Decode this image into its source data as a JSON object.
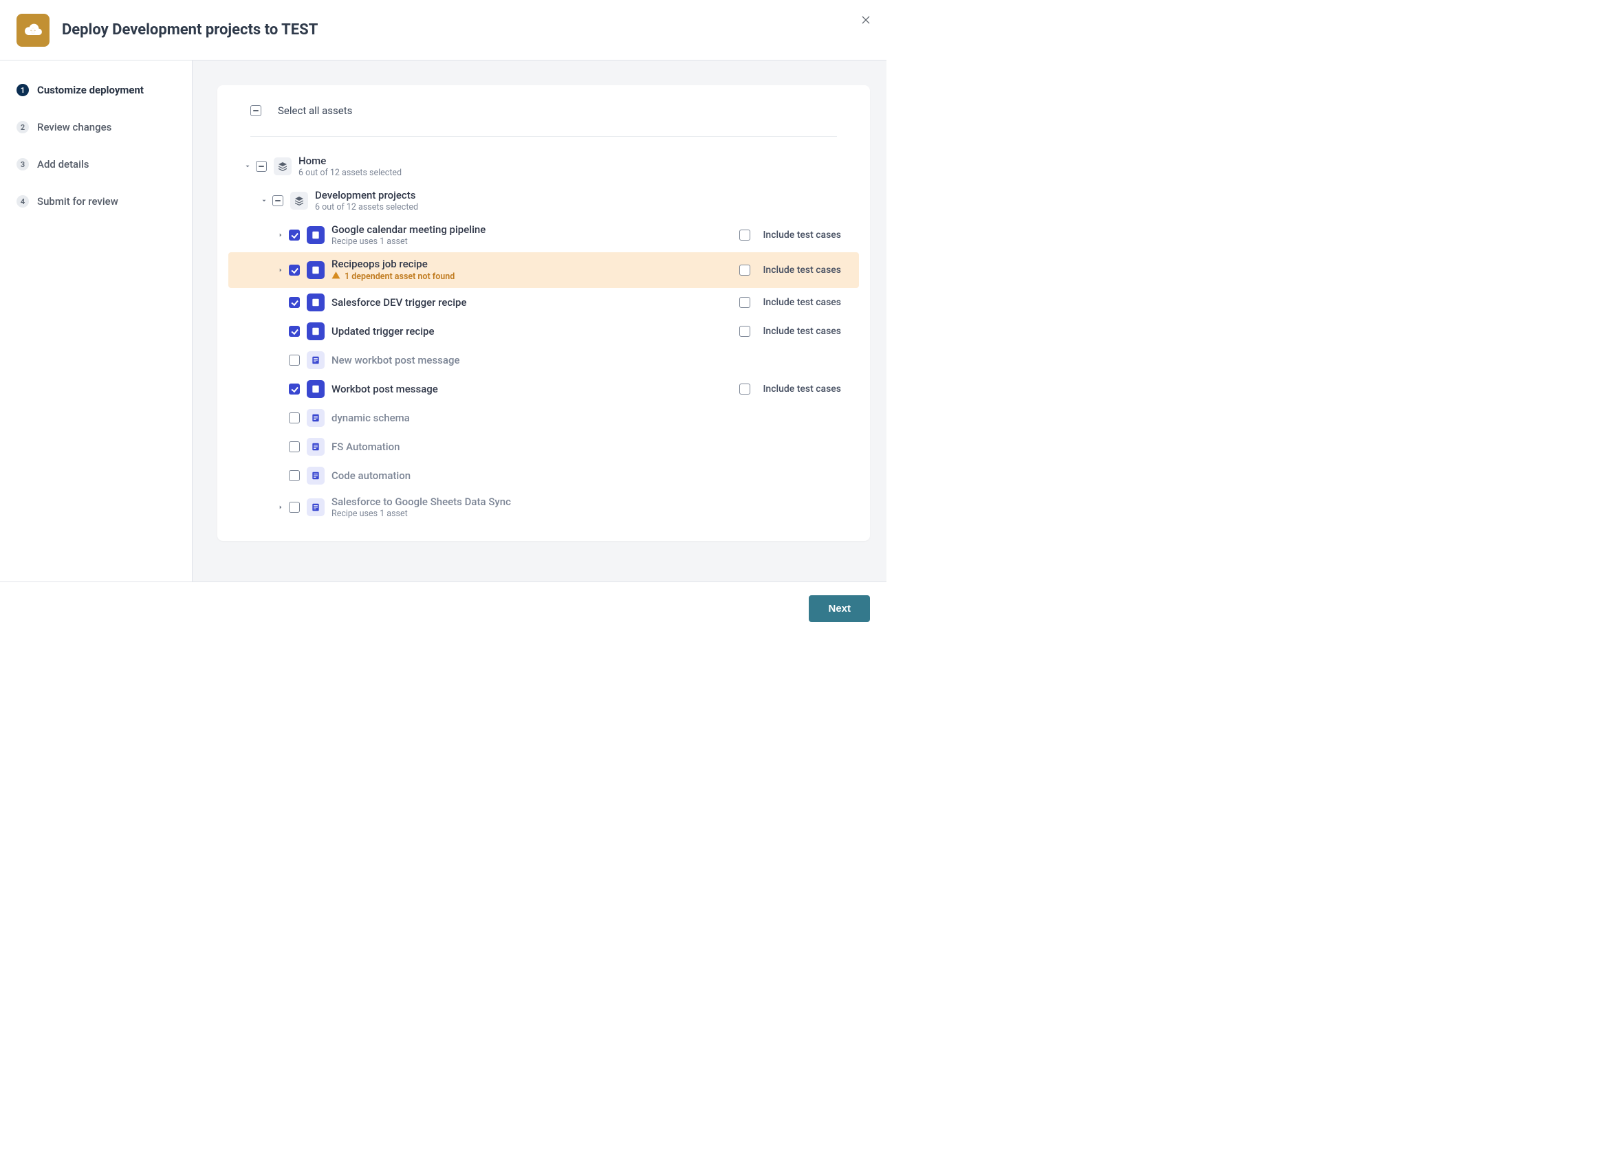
{
  "header": {
    "title": "Deploy Development projects to TEST"
  },
  "sidebar": {
    "steps": [
      {
        "num": "1",
        "label": "Customize deployment",
        "active": true
      },
      {
        "num": "2",
        "label": "Review changes",
        "active": false
      },
      {
        "num": "3",
        "label": "Add details",
        "active": false
      },
      {
        "num": "4",
        "label": "Submit for review",
        "active": false
      }
    ]
  },
  "panel": {
    "select_all_label": "Select all assets",
    "include_test_label": "Include test cases",
    "home": {
      "title": "Home",
      "subtitle": "6 out of 12 assets selected"
    },
    "dev": {
      "title": "Development projects",
      "subtitle": "6 out of 12 assets selected"
    },
    "recipes": [
      {
        "title": "Google calendar meeting pipeline",
        "sub": "Recipe uses 1 asset",
        "checked": true,
        "expandable": true,
        "warn": false,
        "muted": false,
        "show_test": true
      },
      {
        "title": "Recipeops job recipe",
        "sub": "1 dependent asset not found",
        "checked": true,
        "expandable": true,
        "warn": true,
        "muted": false,
        "show_test": true
      },
      {
        "title": "Salesforce DEV trigger recipe",
        "sub": "",
        "checked": true,
        "expandable": false,
        "warn": false,
        "muted": false,
        "show_test": true
      },
      {
        "title": "Updated trigger recipe",
        "sub": "",
        "checked": true,
        "expandable": false,
        "warn": false,
        "muted": false,
        "show_test": true
      },
      {
        "title": "New workbot post message",
        "sub": "",
        "checked": false,
        "expandable": false,
        "warn": false,
        "muted": true,
        "show_test": false
      },
      {
        "title": "Workbot post message",
        "sub": "",
        "checked": true,
        "expandable": false,
        "warn": false,
        "muted": false,
        "show_test": true
      },
      {
        "title": "dynamic schema",
        "sub": "",
        "checked": false,
        "expandable": false,
        "warn": false,
        "muted": true,
        "show_test": false
      },
      {
        "title": "FS Automation",
        "sub": "",
        "checked": false,
        "expandable": false,
        "warn": false,
        "muted": true,
        "show_test": false
      },
      {
        "title": "Code automation",
        "sub": "",
        "checked": false,
        "expandable": false,
        "warn": false,
        "muted": true,
        "show_test": false
      },
      {
        "title": "Salesforce to Google Sheets Data Sync",
        "sub": "Recipe uses 1 asset",
        "checked": false,
        "expandable": true,
        "warn": false,
        "muted": true,
        "show_test": false
      }
    ]
  },
  "footer": {
    "next_label": "Next"
  }
}
